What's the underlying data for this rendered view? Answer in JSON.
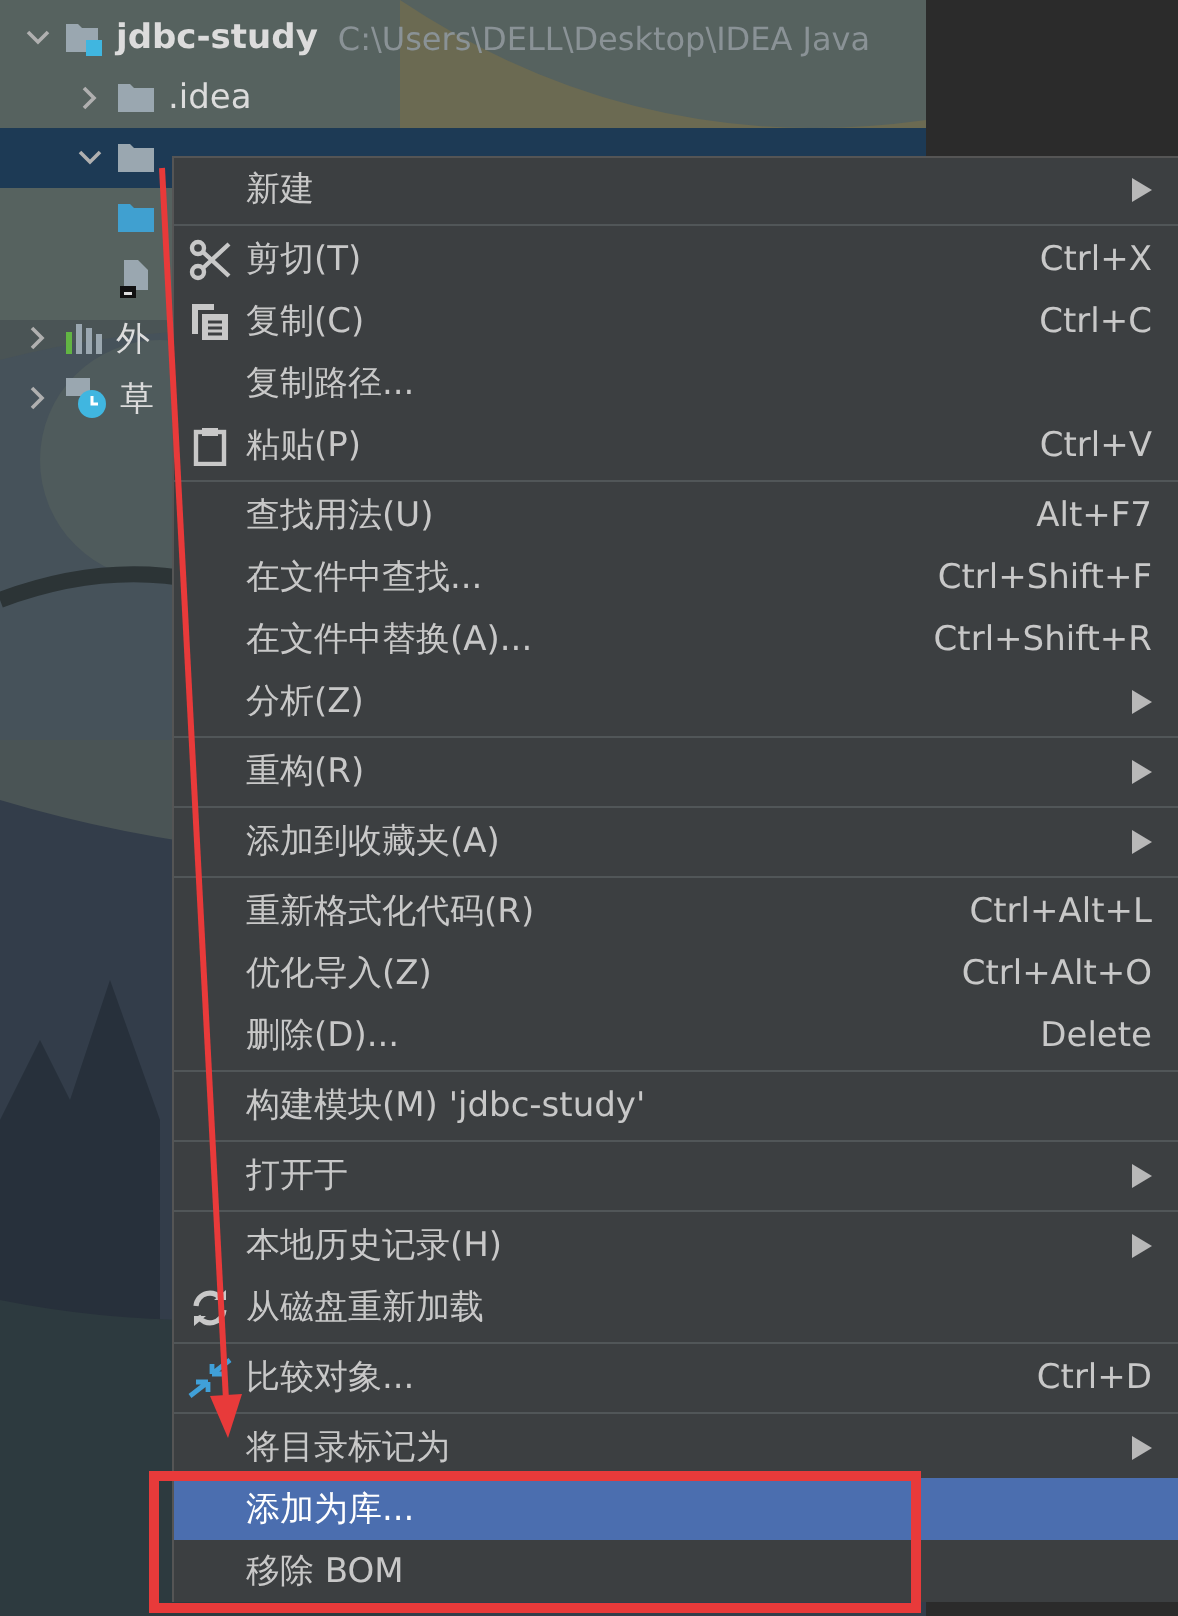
{
  "project_tree": {
    "items": [
      {
        "label": "jdbc-study",
        "path": "C:\\Users\\DELL\\Desktop\\IDEA Java",
        "expanded": true,
        "selected": false,
        "kind": "module",
        "children": [
          {
            "label": ".idea",
            "expanded": false,
            "selected": false,
            "kind": "folder"
          },
          {
            "expanded": true,
            "selected": true,
            "kind": "folder"
          },
          {
            "kind": "blue-folder"
          },
          {
            "kind": "file"
          }
        ]
      },
      {
        "label": "外",
        "expanded": false,
        "selected": false,
        "kind": "libraries"
      },
      {
        "label": "草",
        "expanded": false,
        "selected": false,
        "kind": "scratches"
      }
    ]
  },
  "context_menu": {
    "groups": [
      [
        {
          "label": "新建",
          "submenu": true,
          "selected": false
        }
      ],
      [
        {
          "label": "剪切(T)",
          "shortcut": "Ctrl+X",
          "submenu": false,
          "selected": false,
          "kind": "cut"
        },
        {
          "label": "复制(C)",
          "shortcut": "Ctrl+C",
          "submenu": false,
          "selected": false,
          "kind": "copy"
        },
        {
          "label": "复制路径...",
          "submenu": false,
          "selected": false
        },
        {
          "label": "粘贴(P)",
          "shortcut": "Ctrl+V",
          "submenu": false,
          "selected": false,
          "kind": "paste"
        }
      ],
      [
        {
          "label": "查找用法(U)",
          "shortcut": "Alt+F7",
          "submenu": false,
          "selected": false
        },
        {
          "label": "在文件中查找...",
          "shortcut": "Ctrl+Shift+F",
          "submenu": false,
          "selected": false
        },
        {
          "label": "在文件中替换(A)...",
          "shortcut": "Ctrl+Shift+R",
          "submenu": false,
          "selected": false
        },
        {
          "label": "分析(Z)",
          "submenu": true,
          "selected": false
        }
      ],
      [
        {
          "label": "重构(R)",
          "submenu": true,
          "selected": false
        }
      ],
      [
        {
          "label": "添加到收藏夹(A)",
          "submenu": true,
          "selected": false
        }
      ],
      [
        {
          "label": "重新格式化代码(R)",
          "shortcut": "Ctrl+Alt+L",
          "submenu": false,
          "selected": false
        },
        {
          "label": "优化导入(Z)",
          "shortcut": "Ctrl+Alt+O",
          "submenu": false,
          "selected": false
        },
        {
          "label": "删除(D)...",
          "shortcut": "Delete",
          "submenu": false,
          "selected": false
        }
      ],
      [
        {
          "label": "构建模块(M) 'jdbc-study'",
          "submenu": false,
          "selected": false
        }
      ],
      [
        {
          "label": "打开于",
          "submenu": true,
          "selected": false
        }
      ],
      [
        {
          "label": "本地历史记录(H)",
          "submenu": true,
          "selected": false
        },
        {
          "label": "从磁盘重新加载",
          "submenu": false,
          "selected": false,
          "kind": "reload"
        }
      ],
      [
        {
          "label": "比较对象...",
          "shortcut": "Ctrl+D",
          "submenu": false,
          "selected": false,
          "kind": "compare"
        }
      ],
      [
        {
          "label": "将目录标记为",
          "submenu": true,
          "selected": false
        },
        {
          "label": "添加为库...",
          "submenu": false,
          "selected": true
        },
        {
          "label": "移除 BOM",
          "submenu": false,
          "selected": false
        }
      ]
    ]
  },
  "annotations": {
    "arrow": true,
    "highlight_box": true
  }
}
